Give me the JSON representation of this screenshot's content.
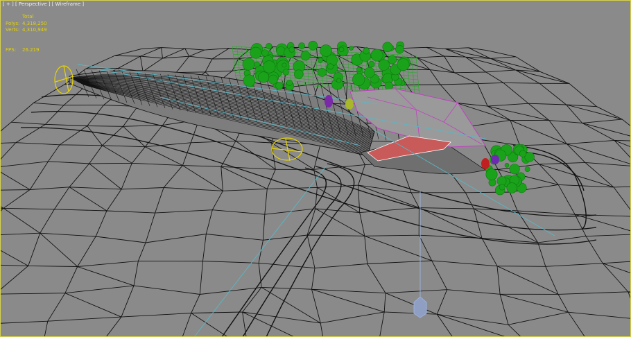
{
  "viewport": {
    "label_parts": [
      "[ + ]",
      "[ Perspective ]",
      "[ Wireframe ]"
    ],
    "background_color": "#8a8a8a",
    "frame_color": "#d8d24a"
  },
  "stats": {
    "header": "Total",
    "polys_label": "Polys:",
    "polys_value": "4,318,250",
    "verts_label": "Verts:",
    "verts_value": "4,310,949",
    "fps_label": "FPS:",
    "fps_value": "26.219",
    "color": "#e6d400"
  },
  "scene_colors": {
    "terrain_wire": "#111111",
    "vegetation": "#1aa21a",
    "vegetation_grid": "#19b019",
    "roof": "#9a9a9a",
    "roof_edge": "#c040c0",
    "camera": "#e8d400",
    "guide_line": "#58b8c8",
    "light_helper": "#9cb0d8"
  }
}
